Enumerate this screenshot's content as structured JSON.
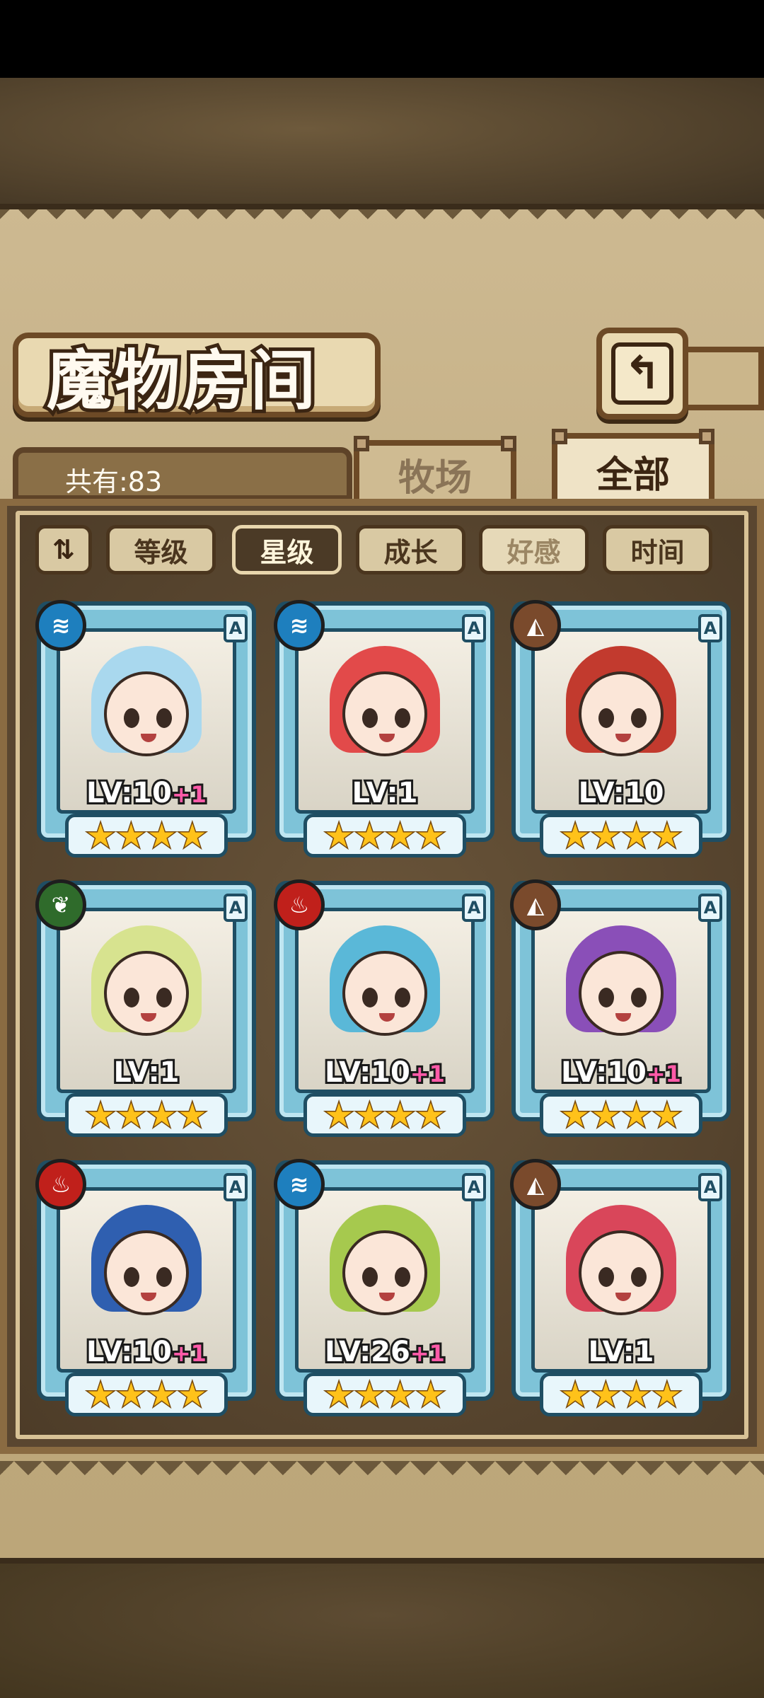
{
  "header": {
    "title": "魔物房间",
    "back_icon": "↰"
  },
  "collection": {
    "count_label": "共有:83"
  },
  "tabs": [
    {
      "label": "牧场",
      "active": false
    },
    {
      "label": "全部",
      "active": true
    }
  ],
  "sort": {
    "toggle_icon": "⇅",
    "buttons": [
      {
        "label": "等级",
        "state": "normal"
      },
      {
        "label": "星级",
        "state": "selected"
      },
      {
        "label": "成长",
        "state": "normal"
      },
      {
        "label": "好感",
        "state": "dim"
      },
      {
        "label": "时间",
        "state": "normal"
      }
    ]
  },
  "monsters": [
    {
      "element": "water",
      "rank": "A",
      "level": "LV:10",
      "bonus": "+1",
      "stars": 4,
      "hair": "#a9d8ee"
    },
    {
      "element": "water",
      "rank": "A",
      "level": "LV:1",
      "bonus": "",
      "stars": 4,
      "hair": "#e24a4a"
    },
    {
      "element": "earth",
      "rank": "A",
      "level": "LV:10",
      "bonus": "",
      "stars": 4,
      "hair": "#c23a2e"
    },
    {
      "element": "wood",
      "rank": "A",
      "level": "LV:1",
      "bonus": "",
      "stars": 4,
      "hair": "#d7e38f"
    },
    {
      "element": "fire",
      "rank": "A",
      "level": "LV:10",
      "bonus": "+1",
      "stars": 4,
      "hair": "#5ab8d8"
    },
    {
      "element": "earth",
      "rank": "A",
      "level": "LV:10",
      "bonus": "+1",
      "stars": 4,
      "hair": "#8a4fb8"
    },
    {
      "element": "fire",
      "rank": "A",
      "level": "LV:10",
      "bonus": "+1",
      "stars": 4,
      "hair": "#2f5fb0"
    },
    {
      "element": "water",
      "rank": "A",
      "level": "LV:26",
      "bonus": "+1",
      "stars": 4,
      "hair": "#a6c94e"
    },
    {
      "element": "earth",
      "rank": "A",
      "level": "LV:1",
      "bonus": "",
      "stars": 4,
      "hair": "#d9465a"
    }
  ],
  "element_icons": {
    "water": "≋",
    "earth": "◭",
    "wood": "❦",
    "fire": "♨"
  },
  "colors": {
    "frame": "#7ec3d8",
    "star": "#ffc21a",
    "bonus": "#ff5aa8"
  }
}
